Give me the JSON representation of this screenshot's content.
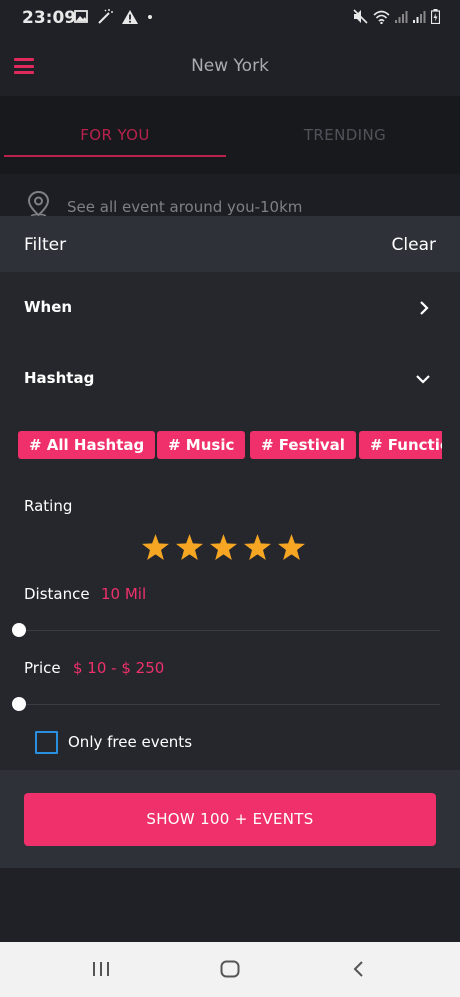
{
  "status": {
    "time": "23:09",
    "icons_left": [
      "image-icon",
      "magic-wand-icon",
      "warning-icon",
      "dot-icon"
    ],
    "icons_right": [
      "mute-icon",
      "wifi-icon",
      "signal-icon",
      "signal-icon",
      "battery-icon"
    ]
  },
  "header": {
    "title": "New York",
    "menu_icon": "hamburger-menu-icon"
  },
  "tabs": [
    {
      "label": "FOR YOU",
      "active": true
    },
    {
      "label": "TRENDING",
      "active": false
    }
  ],
  "location": {
    "icon": "location-pin-icon",
    "text": "See all event around you-10km"
  },
  "filter": {
    "title": "Filter",
    "clear_label": "Clear",
    "when_label": "When",
    "hashtag_label": "Hashtag",
    "hashtags": [
      "# All Hashtag",
      "# Music",
      "# Festival",
      "# Function"
    ],
    "rating_label": "Rating",
    "rating_value": 5,
    "rating_max": 5,
    "distance_label": "Distance",
    "distance_value": "10 Mil",
    "price_label": "Price",
    "price_value": "$ 10 - $ 250",
    "only_free_label": "Only free events",
    "only_free_checked": false,
    "show_button_label": "SHOW 100 + EVENTS"
  },
  "colors": {
    "accent": "#f0306a",
    "star": "#f6a623",
    "checkbox_border": "#2a8fe0",
    "background": "#1f2127"
  },
  "navbar": {
    "icons": [
      "recent-apps-icon",
      "home-icon",
      "back-icon"
    ]
  }
}
